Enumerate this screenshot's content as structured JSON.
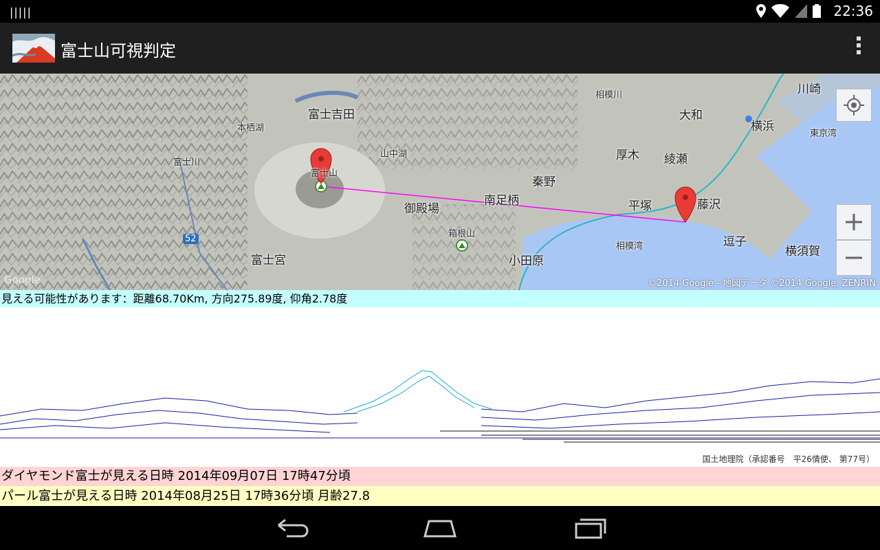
{
  "status": {
    "notification": "|||||",
    "time": "22:36"
  },
  "app": {
    "title": "富士山可視判定"
  },
  "map": {
    "labels": {
      "fujiyoshida": "富士吉田",
      "motosuko": "本栖湖",
      "yamanakako": "山中湖",
      "fujikawa": "富士川",
      "fujisan": "富士山",
      "gotemba": "御殿場",
      "hakone": "箱根山",
      "fujinomiya": "富士宮",
      "route52": "52",
      "odawara": "小田原",
      "minamiashigara": "南足柄",
      "hadano": "秦野",
      "atsugi": "厚木",
      "ayase": "綾瀬",
      "yamato": "大和",
      "sagamigawa": "相模川",
      "hiratsuka": "平塚",
      "fujisawa": "藤沢",
      "sagamiwan": "相模湾",
      "zushi": "逗子",
      "yokosuka": "横須賀",
      "yokohama": "横浜",
      "kawasaki": "川崎",
      "tokyowan": "東京湾",
      "yokohama2": "横浜"
    },
    "logo": "Google",
    "copyright": "©2014 Google - 地図データ ©2014 Google, ZENRIN"
  },
  "result": {
    "visibility": "見える可能性があります：距離68.70Km, 方向275.89度, 仰角2.78度"
  },
  "profile": {
    "credit": "国土地理院（承認番号　平26情使、 第77号）"
  },
  "events": {
    "diamond": "ダイヤモンド富士が見える日時  2014年09月07日 17時47分頃",
    "pearl": "パール富士が見える日時  2014年08月25日 17時36分頃 月齢27.8"
  },
  "colors": {
    "visibility_bg": "#c4ffff",
    "diamond_bg": "#ffd4d4",
    "pearl_bg": "#ffffc4",
    "sea": "#a9c7f5",
    "route_line": "#ff00ff"
  }
}
